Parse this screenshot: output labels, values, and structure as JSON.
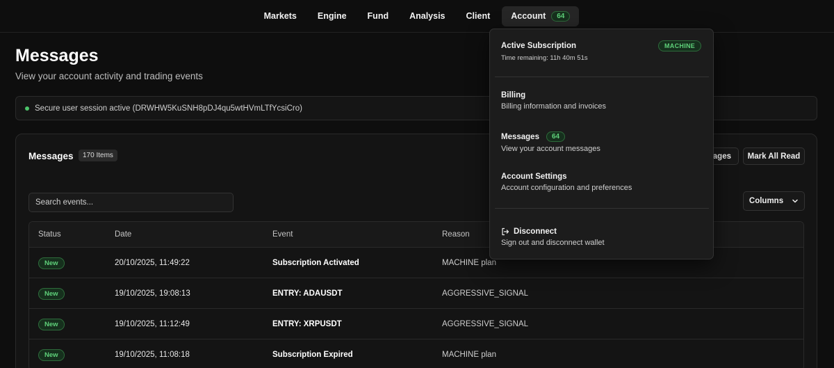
{
  "nav": {
    "items": [
      "Markets",
      "Engine",
      "Fund",
      "Analysis",
      "Client"
    ],
    "account_label": "Account",
    "account_badge": "64"
  },
  "page": {
    "title": "Messages",
    "subtitle": "View your account activity and trading events"
  },
  "session": {
    "text": "Secure user session active (DRWHW5KuSNH8pDJ4qu5wtHVmLTfYcsiCro)"
  },
  "card": {
    "title": "Messages",
    "count": "170 Items",
    "messages_button": "ages",
    "mark_all_read": "Mark All Read",
    "search_placeholder": "Search events...",
    "columns_button": "Columns"
  },
  "table": {
    "headers": [
      "Status",
      "Date",
      "Event",
      "Reason"
    ],
    "rows": [
      {
        "status": "New",
        "date": "20/10/2025, 11:49:22",
        "event": "Subscription Activated",
        "reason": "MACHINE plan"
      },
      {
        "status": "New",
        "date": "19/10/2025, 19:08:13",
        "event": "ENTRY: ADAUSDT",
        "reason": "AGGRESSIVE_SIGNAL"
      },
      {
        "status": "New",
        "date": "19/10/2025, 11:12:49",
        "event": "ENTRY: XRPUSDT",
        "reason": "AGGRESSIVE_SIGNAL"
      },
      {
        "status": "New",
        "date": "19/10/2025, 11:08:18",
        "event": "Subscription Expired",
        "reason": "MACHINE plan"
      }
    ]
  },
  "dropdown": {
    "subscription_title": "Active Subscription",
    "subscription_badge": "MACHINE",
    "time_remaining": "Time remaining: 11h 40m 51s",
    "billing_title": "Billing",
    "billing_desc": "Billing information and invoices",
    "messages_title": "Messages",
    "messages_badge": "64",
    "messages_desc": "View your account messages",
    "settings_title": "Account Settings",
    "settings_desc": "Account configuration and preferences",
    "disconnect_title": "Disconnect",
    "disconnect_desc": "Sign out and disconnect wallet"
  },
  "colors": {
    "accent_green": "#5fd17a",
    "background": "#0e0e0e"
  }
}
